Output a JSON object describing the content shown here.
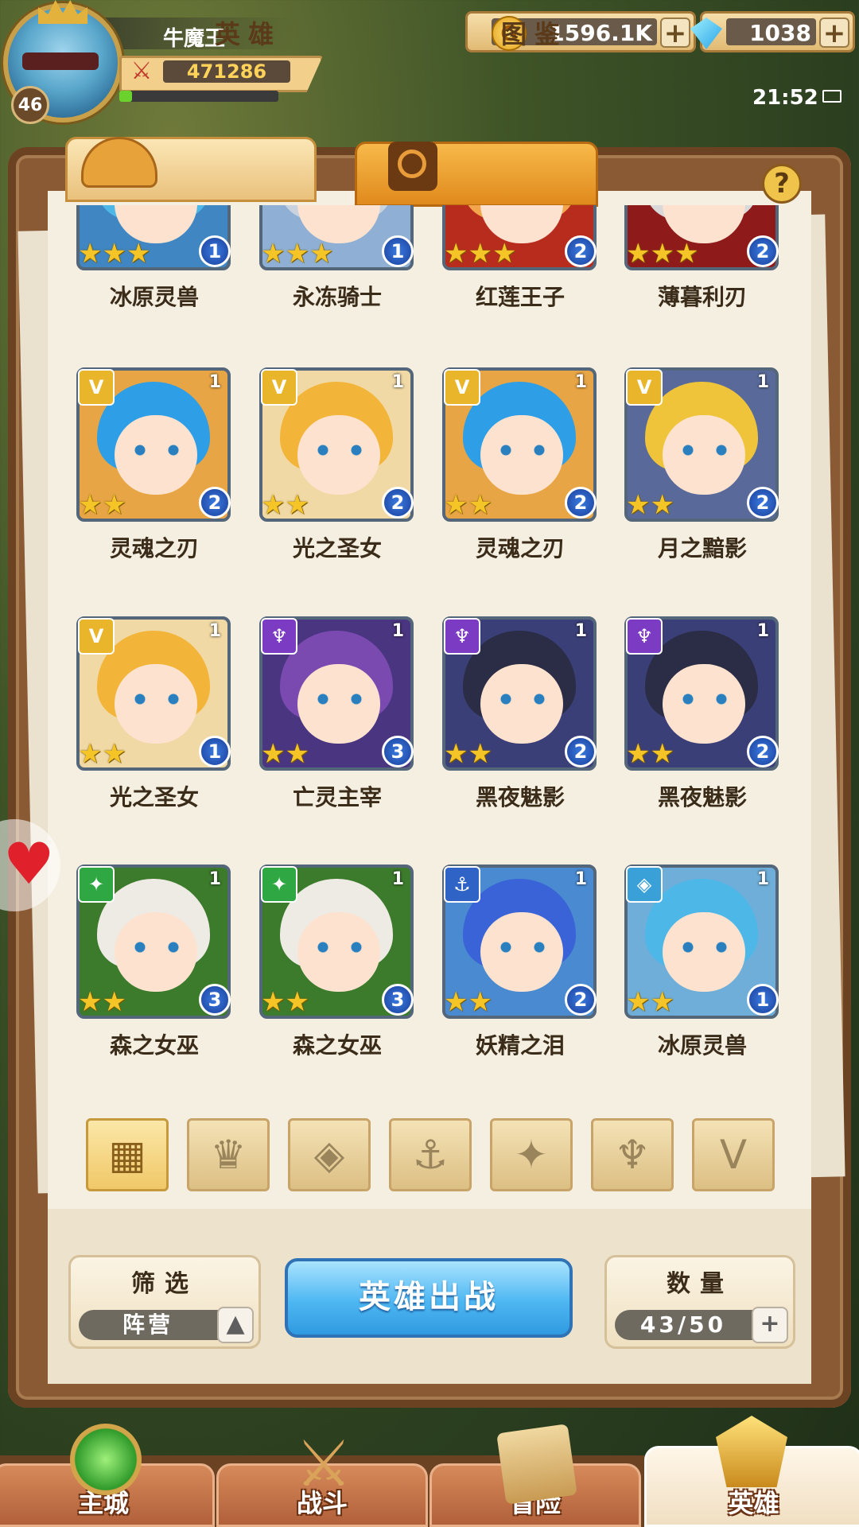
{
  "player": {
    "name": "牛魔王",
    "level": "46",
    "power": "471286",
    "xp_fraction": 0.08
  },
  "currency": {
    "gold": "1596.1K",
    "gold_icon_letter": "G",
    "gems": "1038",
    "plus": "+"
  },
  "status": {
    "time": "21:52"
  },
  "tabs": [
    {
      "label": "英雄"
    },
    {
      "label": "图鉴"
    }
  ],
  "help": "?",
  "heroes": [
    {
      "name": "冰原灵兽",
      "stars": "★★★",
      "badge": "1",
      "faction_icon": "",
      "top_num": "",
      "hair": "#4db7e8",
      "bg": "#3f86c2"
    },
    {
      "name": "永冻骑士",
      "stars": "★★★",
      "badge": "1",
      "faction_icon": "",
      "top_num": "",
      "hair": "#c9d3df",
      "bg": "#8fb0d4"
    },
    {
      "name": "红莲王子",
      "stars": "★★★",
      "badge": "2",
      "faction_icon": "",
      "top_num": "",
      "hair": "#f2a54a",
      "bg": "#b82c1e"
    },
    {
      "name": "薄暮利刃",
      "stars": "★★★",
      "badge": "2",
      "faction_icon": "",
      "top_num": "",
      "hair": "#d9d9d9",
      "bg": "#8f1a1a"
    },
    {
      "name": "灵魂之刃",
      "stars": "★★",
      "badge": "2",
      "faction_icon": "V",
      "faction": "light",
      "top_num": "1",
      "hair": "#2e9fe6",
      "bg": "#e8a545"
    },
    {
      "name": "光之圣女",
      "stars": "★★",
      "badge": "2",
      "faction_icon": "V",
      "faction": "light",
      "top_num": "1",
      "hair": "#f2b53a",
      "bg": "#f1d9a5"
    },
    {
      "name": "灵魂之刃",
      "stars": "★★",
      "badge": "2",
      "faction_icon": "V",
      "faction": "light",
      "top_num": "1",
      "hair": "#2e9fe6",
      "bg": "#e8a545"
    },
    {
      "name": "月之黯影",
      "stars": "★★",
      "badge": "2",
      "faction_icon": "V",
      "faction": "light",
      "top_num": "1",
      "hair": "#f0c43a",
      "bg": "#596a9a"
    },
    {
      "name": "光之圣女",
      "stars": "★★",
      "badge": "1",
      "faction_icon": "V",
      "faction": "light",
      "top_num": "1",
      "hair": "#f2b53a",
      "bg": "#f1d9a5"
    },
    {
      "name": "亡灵主宰",
      "stars": "★★",
      "badge": "3",
      "faction_icon": "♆",
      "faction": "dark",
      "top_num": "1",
      "hair": "#7a4ab0",
      "bg": "#4a3580"
    },
    {
      "name": "黑夜魅影",
      "stars": "★★",
      "badge": "2",
      "faction_icon": "♆",
      "faction": "dark",
      "top_num": "1",
      "hair": "#2a2d45",
      "bg": "#3b3f78"
    },
    {
      "name": "黑夜魅影",
      "stars": "★★",
      "badge": "2",
      "faction_icon": "♆",
      "faction": "dark",
      "top_num": "1",
      "hair": "#2a2d45",
      "bg": "#3b3f78"
    },
    {
      "name": "森之女巫",
      "stars": "★★",
      "badge": "3",
      "faction_icon": "✦",
      "faction": "forest",
      "top_num": "1",
      "hair": "#eeeae4",
      "bg": "#3c7a2c"
    },
    {
      "name": "森之女巫",
      "stars": "★★",
      "badge": "3",
      "faction_icon": "✦",
      "faction": "forest",
      "top_num": "1",
      "hair": "#eeeae4",
      "bg": "#3c7a2c"
    },
    {
      "name": "妖精之泪",
      "stars": "★★",
      "badge": "2",
      "faction_icon": "⚓",
      "faction": "water",
      "top_num": "1",
      "hair": "#3a63d8",
      "bg": "#4a8ad0"
    },
    {
      "name": "冰原灵兽",
      "stars": "★★",
      "badge": "1",
      "faction_icon": "◈",
      "faction": "ice",
      "top_num": "1",
      "hair": "#4db7e8",
      "bg": "#6faed8"
    }
  ],
  "faction_colors": {
    "light": "#e9b52a",
    "dark": "#7b3bc2",
    "forest": "#2fa844",
    "water": "#2f63c6",
    "ice": "#3aa0d8"
  },
  "filters": [
    {
      "icon": "grid-icon",
      "glyph": "▦"
    },
    {
      "icon": "crown-icon",
      "glyph": "♛"
    },
    {
      "icon": "diamond-icon",
      "glyph": "◈"
    },
    {
      "icon": "anchor-icon",
      "glyph": "⚓"
    },
    {
      "icon": "beast-icon",
      "glyph": "✦"
    },
    {
      "icon": "horns-icon",
      "glyph": "♆"
    },
    {
      "icon": "wing-icon",
      "glyph": "V"
    }
  ],
  "controls": {
    "filter_title": "筛选",
    "filter_value": "阵营",
    "filter_toggle": "▲",
    "deploy": "英雄出战",
    "count_title": "数量",
    "count_value": "43/50",
    "count_plus": "+"
  },
  "nav": [
    {
      "label": "主城"
    },
    {
      "label": "战斗"
    },
    {
      "label": "冒险"
    },
    {
      "label": "英雄"
    }
  ]
}
